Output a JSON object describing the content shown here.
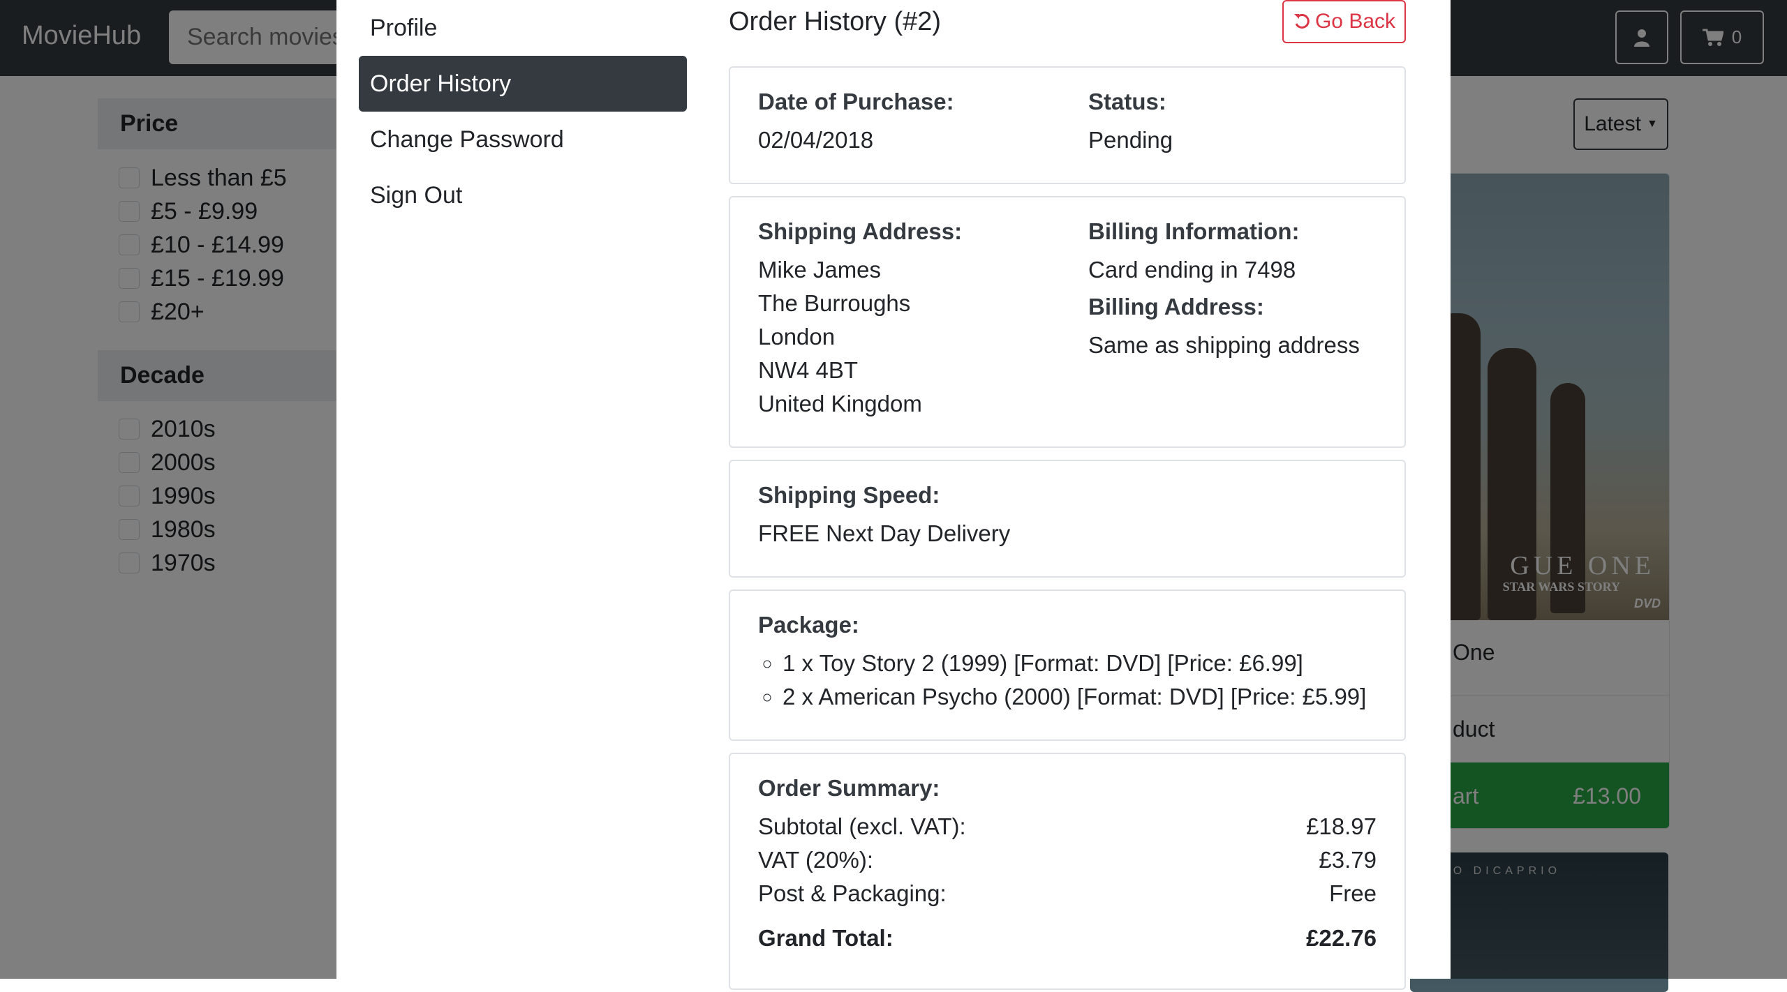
{
  "navbar": {
    "brand": "MovieHub",
    "search_placeholder": "Search movies",
    "cart_count": "0",
    "user_icon": "user-icon",
    "cart_icon": "cart-icon"
  },
  "filters": {
    "price": {
      "title": "Price",
      "options": [
        "Less than £5",
        "£5 - £9.99",
        "£10 - £14.99",
        "£15 - £19.99",
        "£20+"
      ]
    },
    "decade": {
      "title": "Decade",
      "options": [
        "2010s",
        "2000s",
        "1990s",
        "1980s",
        "1970s"
      ]
    }
  },
  "sort": {
    "label": "Latest"
  },
  "movie_card": {
    "poster_title": "GUE ONE",
    "poster_subtitle": "STAR WARS STORY",
    "poster_badge": "DVD",
    "title": "One",
    "link": "duct",
    "add_label": "art",
    "price": "£13.00"
  },
  "movie_card_2": {
    "poster_text": "ARDO DICAPRIO"
  },
  "modal": {
    "side_nav": [
      "Profile",
      "Order History",
      "Change Password",
      "Sign Out"
    ],
    "active_index": 1,
    "title": "Order History (#2)",
    "go_back": "Go Back",
    "purchase": {
      "date_label": "Date of Purchase:",
      "date": "02/04/2018",
      "status_label": "Status:",
      "status": "Pending"
    },
    "shipping": {
      "address_label": "Shipping Address:",
      "address": [
        "Mike James",
        "The Burroughs",
        "London",
        "NW4 4BT",
        "United Kingdom"
      ],
      "billing_label": "Billing Information:",
      "card": "Card ending in 7498",
      "billing_address_label": "Billing Address:",
      "billing_address": "Same as shipping address"
    },
    "speed": {
      "label": "Shipping Speed:",
      "value": "FREE Next Day Delivery"
    },
    "package": {
      "label": "Package:",
      "items": [
        "1 x Toy Story 2 (1999) [Format: DVD] [Price: £6.99]",
        "2 x American Psycho (2000) [Format: DVD] [Price: £5.99]"
      ]
    },
    "summary": {
      "label": "Order Summary:",
      "rows": [
        {
          "name": "Subtotal (excl. VAT):",
          "value": "£18.97"
        },
        {
          "name": "VAT (20%):",
          "value": "£3.79"
        },
        {
          "name": "Post & Packaging:",
          "value": "Free"
        }
      ],
      "total_name": "Grand Total:",
      "total_value": "£22.76"
    }
  }
}
